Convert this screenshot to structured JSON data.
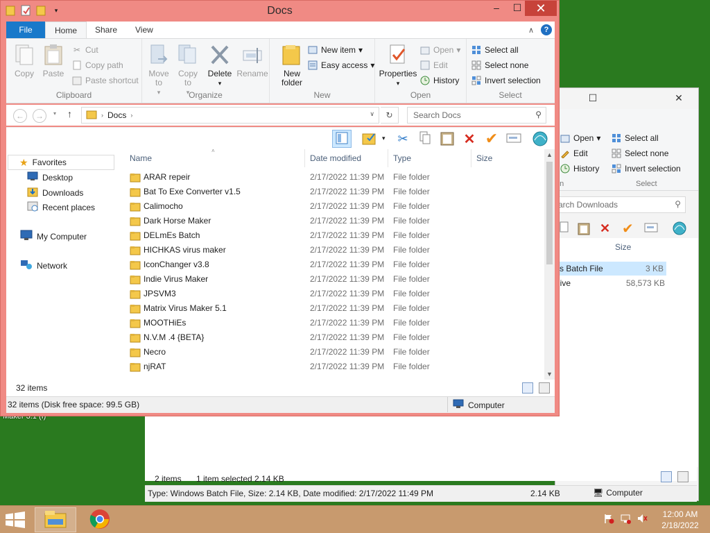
{
  "desktop": {
    "fragment_label": "Maker 3.1 (I)"
  },
  "window": {
    "title": "Docs",
    "ribbon_tabs": [
      "File",
      "Home",
      "Share",
      "View"
    ],
    "clipboard": {
      "copy": "Copy",
      "paste": "Paste",
      "cut": "Cut",
      "copy_path": "Copy path",
      "paste_shortcut": "Paste shortcut",
      "group": "Clipboard"
    },
    "organize": {
      "move_to": "Move to",
      "copy_to": "Copy to",
      "delete": "Delete",
      "rename": "Rename",
      "group": "Organize"
    },
    "new": {
      "new_folder": "New folder",
      "new_item": "New item",
      "easy_access": "Easy access",
      "group": "New"
    },
    "open": {
      "properties": "Properties",
      "open": "Open",
      "edit": "Edit",
      "history": "History",
      "group": "Open"
    },
    "select": {
      "select_all": "Select all",
      "select_none": "Select none",
      "invert": "Invert selection",
      "group": "Select"
    },
    "address": {
      "path_item": "Docs",
      "search_placeholder": "Search Docs"
    },
    "nav": {
      "favorites": "Favorites",
      "fav_items": [
        "Desktop",
        "Downloads",
        "Recent places"
      ],
      "computer": "My Computer",
      "network": "Network"
    },
    "columns": {
      "name": "Name",
      "date": "Date modified",
      "type": "Type",
      "size": "Size"
    },
    "files": [
      {
        "name": "ARAR repeir",
        "date": "2/17/2022 11:39 PM",
        "type": "File folder"
      },
      {
        "name": "Bat To Exe Converter v1.5",
        "date": "2/17/2022 11:39 PM",
        "type": "File folder"
      },
      {
        "name": "Calimocho",
        "date": "2/17/2022 11:39 PM",
        "type": "File folder"
      },
      {
        "name": "Dark Horse Maker",
        "date": "2/17/2022 11:39 PM",
        "type": "File folder"
      },
      {
        "name": "DELmEs Batch",
        "date": "2/17/2022 11:39 PM",
        "type": "File folder"
      },
      {
        "name": "HICHKAS virus maker",
        "date": "2/17/2022 11:39 PM",
        "type": "File folder"
      },
      {
        "name": "IconChanger v3.8",
        "date": "2/17/2022 11:39 PM",
        "type": "File folder"
      },
      {
        "name": "Indie Virus Maker",
        "date": "2/17/2022 11:39 PM",
        "type": "File folder"
      },
      {
        "name": "JPSVM3",
        "date": "2/17/2022 11:39 PM",
        "type": "File folder"
      },
      {
        "name": "Matrix Virus Maker 5.1",
        "date": "2/17/2022 11:39 PM",
        "type": "File folder"
      },
      {
        "name": "MOOTHiEs",
        "date": "2/17/2022 11:39 PM",
        "type": "File folder"
      },
      {
        "name": "N.V.M .4 {BETA}",
        "date": "2/17/2022 11:39 PM",
        "type": "File folder"
      },
      {
        "name": "Necro",
        "date": "2/17/2022 11:39 PM",
        "type": "File folder"
      },
      {
        "name": "njRAT",
        "date": "2/17/2022 11:39 PM",
        "type": "File folder"
      }
    ],
    "item_count": "32 items",
    "status": "32 items (Disk free space: 99.5 GB)",
    "status_location": "Computer"
  },
  "bg_window": {
    "open": "Open",
    "edit": "Edit",
    "history": "History",
    "group_open_fragment": "en",
    "select_all": "Select all",
    "select_none": "Select none",
    "invert": "Invert selection",
    "group_select": "Select",
    "search_fragment": "arch Downloads",
    "size_header": "Size",
    "rows": [
      {
        "name_fragment": "vs Batch File",
        "size": "3 KB"
      },
      {
        "name_fragment": "hive",
        "size": "58,573 KB"
      }
    ],
    "items": "2 items",
    "selected": "1 item selected  2.14 KB",
    "details": "Type: Windows Batch File, Size: 2.14 KB, Date modified: 2/17/2022 11:49 PM",
    "details_size": "2.14 KB",
    "details_location": "Computer"
  },
  "taskbar": {
    "time": "12:00 AM",
    "date": "2/18/2022"
  },
  "colors": {
    "frame": "#f08a84",
    "file_tab": "#1979ca",
    "close_btn": "#c7433a",
    "taskbar": "#c89a6e"
  }
}
